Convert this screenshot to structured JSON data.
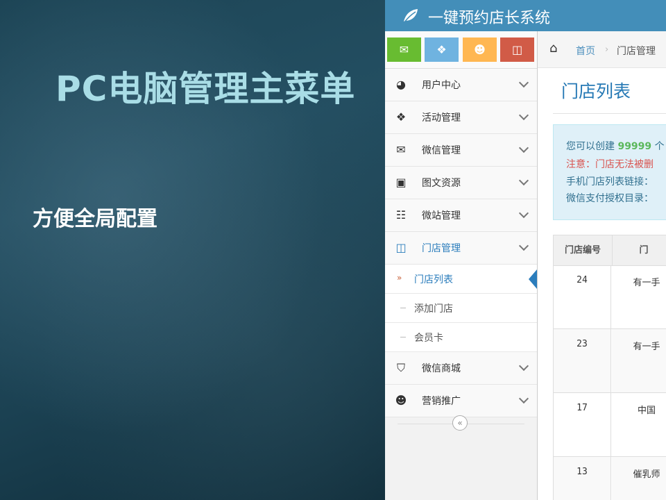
{
  "slide": {
    "title": "PC电脑管理主菜单",
    "subtitle": "方便全局配置"
  },
  "app": {
    "brand": "一键预约店长系统",
    "brand_icon": "leaf-icon",
    "colors": {
      "topbar": "#438eb9",
      "active": "#2b7dbc"
    },
    "shortcuts": [
      {
        "icon": "comments-icon",
        "color": "#68bc31"
      },
      {
        "icon": "gift-icon",
        "color": "#6fb3e0"
      },
      {
        "icon": "group-icon",
        "color": "#ffb752"
      },
      {
        "icon": "columns-icon",
        "color": "#d15b47"
      }
    ],
    "nav": [
      {
        "label": "用户中心",
        "icon": "dashboard-icon"
      },
      {
        "label": "活动管理",
        "icon": "gift-icon"
      },
      {
        "label": "微信管理",
        "icon": "comments-icon"
      },
      {
        "label": "图文资源",
        "icon": "picture-icon"
      },
      {
        "label": "微站管理",
        "icon": "sitemap-icon"
      },
      {
        "label": "门店管理",
        "icon": "columns-icon"
      },
      {
        "label": "微信商城",
        "icon": "cart-icon"
      },
      {
        "label": "营销推广",
        "icon": "group-icon"
      }
    ],
    "subnav": [
      {
        "label": "门店列表"
      },
      {
        "label": "添加门店"
      },
      {
        "label": "会员卡"
      }
    ],
    "breadcrumb": {
      "home": "首页",
      "current": "门店管理"
    },
    "page_title": "门店列表",
    "alert": {
      "line1_prefix": "您可以创建",
      "line1_num": "99999",
      "line1_suffix": "个",
      "line2": "注意：门店无法被删",
      "line3": "手机门店列表链接：",
      "line4": "微信支付授权目录："
    },
    "table": {
      "headers": [
        "门店编号",
        "门"
      ],
      "rows": [
        {
          "id": "24",
          "name": "有一手"
        },
        {
          "id": "23",
          "name": "有一手"
        },
        {
          "id": "17",
          "name": "中国"
        },
        {
          "id": "13",
          "name": "催乳师"
        }
      ]
    }
  }
}
